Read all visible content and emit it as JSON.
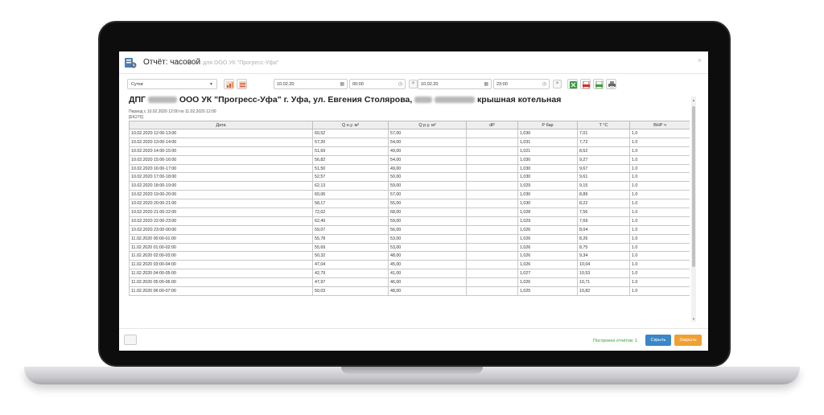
{
  "dialog": {
    "title": "Отчёт: часовой",
    "subtitle": "для ООО УК \"Прогресс-Уфа\"",
    "close": "×"
  },
  "toolbar": {
    "period_select": "Сутки",
    "date_from": "10.02.20",
    "time_from": "00:00",
    "date_to": "10.02.20",
    "time_to": "23:00",
    "clear": "×"
  },
  "report": {
    "title_prefix": "ДПГ",
    "title_middle": "ООО УК \"Прогресс-Уфа\" г. Уфа, ул. Евгения Столярова,",
    "title_suffix": "крышная котельная",
    "period": "Период с 10.02.2020 12:00 по 11.02.2020 12:00",
    "device": "[EK270]"
  },
  "table": {
    "headers": [
      "Дата",
      "Q н.у. м³",
      "Q р.у. м³",
      "dP",
      "P бар",
      "T °С",
      "ВНР ч"
    ],
    "rows": [
      [
        "10.02.2020 12:00-13:00",
        "60,52",
        "57,00",
        "",
        "1,030",
        "7,01",
        "1.0"
      ],
      [
        "10.02.2020 13:00-14:00",
        "57,20",
        "54,00",
        "",
        "1,031",
        "7,72",
        "1.0"
      ],
      [
        "10.02.2020 14:00-15:00",
        "51,69",
        "49,00",
        "",
        "1,021",
        "8,62",
        "1.0"
      ],
      [
        "10.02.2020 15:00-16:00",
        "56,82",
        "54,00",
        "",
        "1,030",
        "9,27",
        "1.0"
      ],
      [
        "10.02.2020 16:00-17:00",
        "51,50",
        "49,00",
        "",
        "1,030",
        "9,67",
        "1.0"
      ],
      [
        "10.02.2020 17:00-18:00",
        "52,57",
        "50,00",
        "",
        "1,030",
        "9,61",
        "1.0"
      ],
      [
        "10.02.2020 18:00-19:00",
        "62,13",
        "59,00",
        "",
        "1,029",
        "9,15",
        "1.0"
      ],
      [
        "10.02.2020 19:00-20:00",
        "60,06",
        "57,00",
        "",
        "1,030",
        "8,89",
        "1.0"
      ],
      [
        "10.02.2020 20:00-21:00",
        "58,17",
        "55,00",
        "",
        "1,030",
        "8,22",
        "1.0"
      ],
      [
        "10.02.2020 21:00-22:00",
        "72,02",
        "68,00",
        "",
        "1,028",
        "7,56",
        "1.0"
      ],
      [
        "10.02.2020 22:00-23:00",
        "62,49",
        "59,00",
        "",
        "1,029",
        "7,69",
        "1.0"
      ],
      [
        "10.02.2020 23:00-00:00",
        "59,07",
        "56,00",
        "",
        "1,026",
        "8,04",
        "1.0"
      ],
      [
        "11.02.2020 00:00-01:00",
        "55,78",
        "53,00",
        "",
        "1,026",
        "8,26",
        "1.0"
      ],
      [
        "11.02.2020 01:00-02:00",
        "55,69",
        "53,00",
        "",
        "1,026",
        "8,75",
        "1.0"
      ],
      [
        "11.02.2020 02:00-03:00",
        "50,32",
        "48,00",
        "",
        "1,026",
        "9,34",
        "1.0"
      ],
      [
        "11.02.2020 03:00-04:00",
        "47,04",
        "45,00",
        "",
        "1,026",
        "10,04",
        "1.0"
      ],
      [
        "11.02.2020 04:00-05:00",
        "42,79",
        "41,00",
        "",
        "1,027",
        "10,53",
        "1.0"
      ],
      [
        "11.02.2020 05:00-06:00",
        "47,97",
        "46,00",
        "",
        "1,026",
        "10,71",
        "1.0"
      ],
      [
        "11.02.2020 06:00-07:00",
        "50,03",
        "48,00",
        "",
        "1,025",
        "10,82",
        "1.0"
      ]
    ]
  },
  "footer": {
    "status": "Построено отчётов: 1",
    "hide_label": "Скрыть",
    "close_label": "Закрыть"
  },
  "colors": {
    "accent_blue": "#3a87c8",
    "accent_orange": "#f0a032",
    "status_green": "#2f9a2f"
  }
}
